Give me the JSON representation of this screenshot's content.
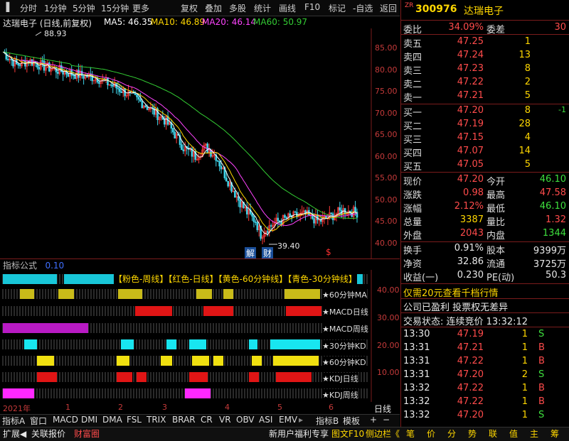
{
  "toolbar": {
    "items": [
      "分时",
      "1分钟",
      "5分钟",
      "15分钟",
      "更多",
      "复权",
      "叠加",
      "多股",
      "统计",
      "画线",
      "F10",
      "标记",
      "-自选",
      "返回"
    ]
  },
  "chart": {
    "title": "达瑞电子 (日线,前复权)",
    "ma5": "MA5: 46.35",
    "ma10": "MA10: 46.89",
    "ma20": "MA20: 46.14",
    "ma60": "MA60: 50.97",
    "high_label": "88.93",
    "low_label": "39.40",
    "marker_jie": "解",
    "marker_cai": "财",
    "marker_s": "$",
    "price_ticks": [
      "85.00",
      "80.00",
      "75.00",
      "70.00",
      "65.00",
      "60.00",
      "55.00",
      "50.00",
      "45.00",
      "40.00"
    ],
    "price_scale_min": 37.5,
    "price_scale_max": 87.5,
    "colors": {
      "ma5": "#ffffff",
      "ma10": "#ffd700",
      "ma20": "#ff44ff",
      "ma60": "#33cc33"
    }
  },
  "indicator": {
    "title": "指标公式",
    "value": "0.10",
    "ticks": [
      "40.00",
      "30.00",
      "20.00",
      "10.00"
    ],
    "legend": "【粉色-周线】【红色-日线】【黄色-60分钟线】【青色-30分钟线】",
    "rows": [
      {
        "label": "★60分钟MA",
        "color": "#ff44ff"
      },
      {
        "label": "★MACD日线",
        "color": "#ffd700"
      },
      {
        "label": "★MACD周线",
        "color": "#ffd700"
      },
      {
        "label": "★30分钟KD",
        "color": "#ff44ff"
      },
      {
        "label": "★60分钟KD",
        "color": "#ff44ff"
      },
      {
        "label": "★KDJ日线",
        "color": "#ffffff"
      },
      {
        "label": "★KDJ周线",
        "color": "#3fd2e8"
      }
    ]
  },
  "xaxis": {
    "labels": [
      "2021年",
      "1",
      "2",
      "3",
      "4",
      "5",
      "6"
    ],
    "period": "日线"
  },
  "bottom_tabs": [
    "指标A",
    "窗口",
    "MACD",
    "DMI",
    "DMA",
    "FSL",
    "TRIX",
    "BRAR",
    "CR",
    "VR",
    "OBV",
    "ASI",
    "EMV",
    "指标B",
    "模板"
  ],
  "bottom_bar": {
    "left": [
      "扩展◀",
      "关联报价",
      "财富圈"
    ],
    "mid": [
      "新用户福利专享",
      "图文F10",
      "侧边栏《"
    ],
    "right_tabs": [
      "笔",
      "价",
      "分",
      "势",
      "联",
      "值",
      "主",
      "筹"
    ]
  },
  "quote": {
    "code": "300976",
    "name": "达瑞电子",
    "tag": "ZR",
    "weibi_label": "委比",
    "weibi": "34.09%",
    "weicha_label": "委差",
    "weicha": "30",
    "sell": [
      {
        "label": "卖五",
        "price": "47.25",
        "vol": "1"
      },
      {
        "label": "卖四",
        "price": "47.24",
        "vol": "13"
      },
      {
        "label": "卖三",
        "price": "47.23",
        "vol": "8"
      },
      {
        "label": "卖二",
        "price": "47.22",
        "vol": "2"
      },
      {
        "label": "卖一",
        "price": "47.21",
        "vol": "5"
      }
    ],
    "buy": [
      {
        "label": "买一",
        "price": "47.20",
        "vol": "8",
        "chg": "-1"
      },
      {
        "label": "买二",
        "price": "47.19",
        "vol": "28",
        "chg": ""
      },
      {
        "label": "买三",
        "price": "47.15",
        "vol": "4",
        "chg": ""
      },
      {
        "label": "买四",
        "price": "47.07",
        "vol": "14",
        "chg": ""
      },
      {
        "label": "买五",
        "price": "47.05",
        "vol": "5",
        "chg": ""
      }
    ],
    "stats": [
      {
        "l1": "现价",
        "v1": "47.20",
        "c1": "red",
        "l2": "今开",
        "v2": "46.10",
        "c2": "green"
      },
      {
        "l1": "涨跌",
        "v1": "0.98",
        "c1": "red",
        "l2": "最高",
        "v2": "47.58",
        "c2": "red"
      },
      {
        "l1": "涨幅",
        "v1": "2.12%",
        "c1": "red",
        "l2": "最低",
        "v2": "46.10",
        "c2": "green"
      },
      {
        "l1": "总量",
        "v1": "3387",
        "c1": "yel",
        "l2": "量比",
        "v2": "1.32",
        "c2": "red"
      },
      {
        "l1": "外盘",
        "v1": "2043",
        "c1": "red",
        "l2": "内盘",
        "v2": "1344",
        "c2": "green"
      }
    ],
    "stats2": [
      {
        "l1": "换手",
        "v1": "0.91%",
        "l2": "股本",
        "v2": "9399万"
      },
      {
        "l1": "净资",
        "v1": "32.86",
        "l2": "流通",
        "v2": "3725万"
      },
      {
        "l1": "收益(一)",
        "v1": "0.230",
        "l2": "PE(动)",
        "v2": "50.3"
      }
    ],
    "promo": "仅需20元查看千档行情",
    "profit": "公司已盈利 投票权无差异",
    "status": "交易状态: 连续竞价 13:32:12",
    "ticks": [
      {
        "time": "13:30",
        "price": "47.19",
        "vol": "1",
        "bs": "S"
      },
      {
        "time": "13:31",
        "price": "47.21",
        "vol": "1",
        "bs": "B"
      },
      {
        "time": "13:31",
        "price": "47.22",
        "vol": "1",
        "bs": "B"
      },
      {
        "time": "13:31",
        "price": "47.20",
        "vol": "2",
        "bs": "S"
      },
      {
        "time": "13:32",
        "price": "47.22",
        "vol": "1",
        "bs": "B"
      },
      {
        "time": "13:32",
        "price": "47.22",
        "vol": "1",
        "bs": "B"
      },
      {
        "time": "13:32",
        "price": "47.20",
        "vol": "1",
        "bs": "S"
      }
    ]
  }
}
